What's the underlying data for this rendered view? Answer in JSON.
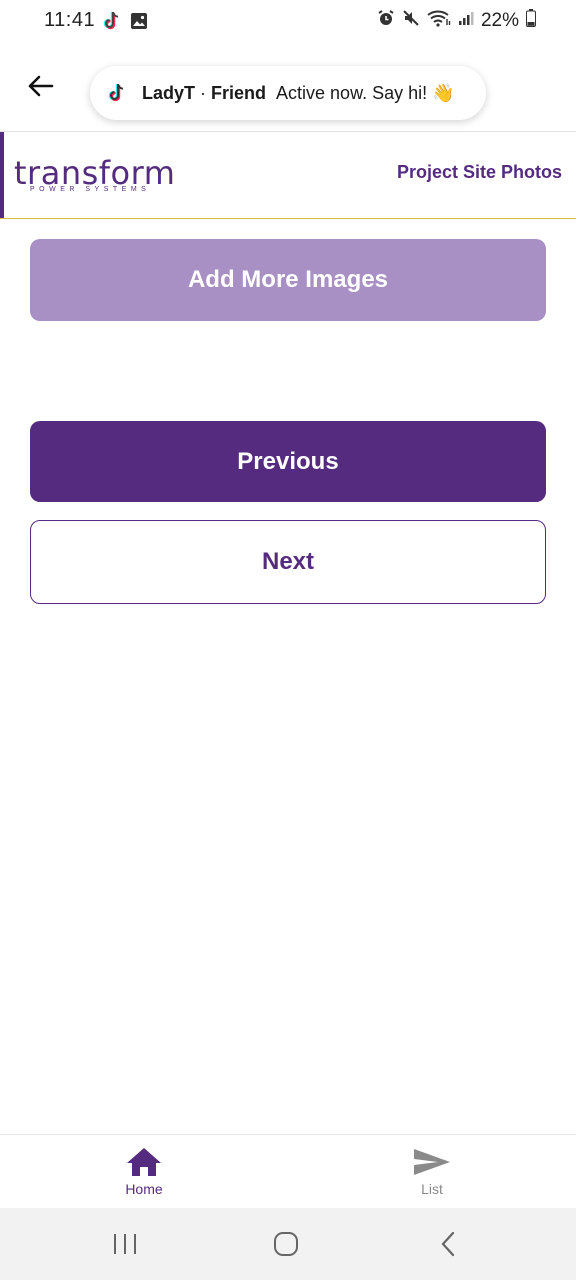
{
  "status_bar": {
    "time": "11:41",
    "battery_percent": "22%",
    "left_icons": [
      "tiktok-icon",
      "image-icon"
    ],
    "right_icons": [
      "alarm-icon",
      "mute-icon",
      "wifi-icon",
      "signal-icon",
      "battery-icon"
    ]
  },
  "toast": {
    "name": "LadyT",
    "separator": "·",
    "relation": "Friend",
    "message": "Active now. Say hi! 👋"
  },
  "header": {
    "logo_text": "transform",
    "logo_subtext": "POWER SYSTEMS",
    "page_title": "Project Site Photos"
  },
  "buttons": {
    "add_images": "Add More Images",
    "previous": "Previous",
    "next": "Next"
  },
  "bottom_nav": {
    "items": [
      {
        "label": "Home",
        "icon": "home-icon",
        "active": true
      },
      {
        "label": "List",
        "icon": "send-icon",
        "active": false
      }
    ]
  },
  "colors": {
    "brand": "#552b80",
    "brand_light": "#a890c5",
    "accent_line": "#d8c23e"
  }
}
